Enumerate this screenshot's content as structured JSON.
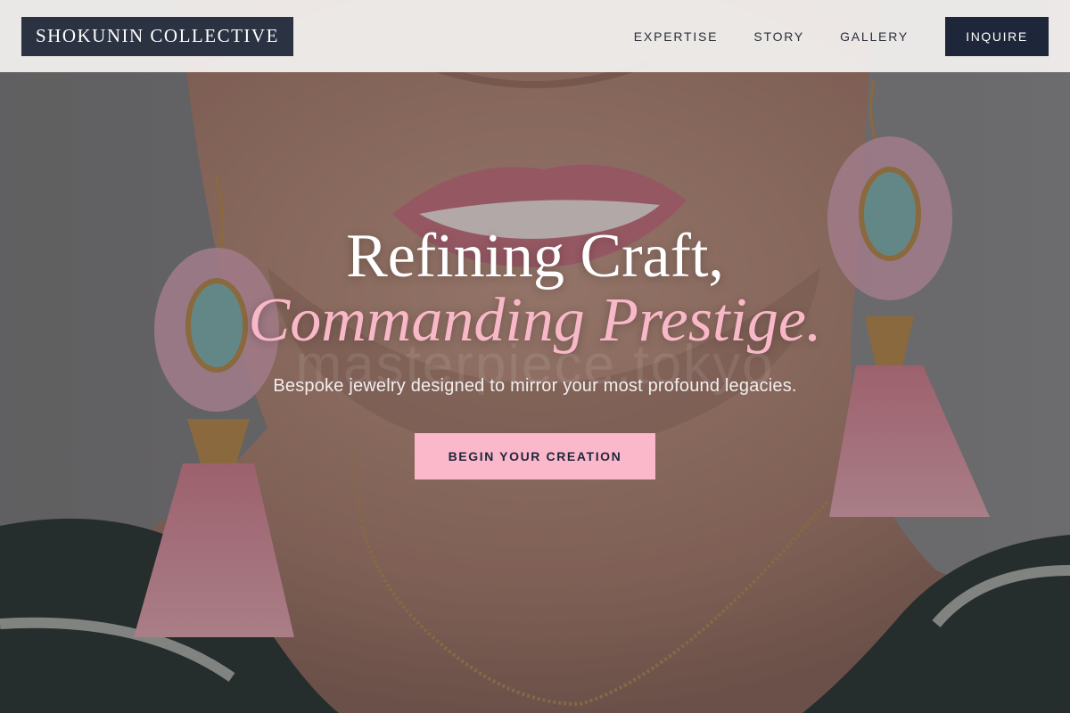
{
  "navbar": {
    "brand": "SHOKUNIN COLLECTIVE",
    "links": [
      "EXPERTISE",
      "STORY",
      "GALLERY"
    ],
    "inquire_label": "INQUIRE"
  },
  "hero": {
    "title_line_1": "Refining Craft,",
    "title_line_2": "Commanding Prestige.",
    "watermark": "masterpiece.tokyo",
    "subtitle": "Bespoke jewelry designed to mirror your most profound legacies.",
    "cta_label": "BEGIN YOUR CREATION",
    "image_subject": "model wearing pink beaded tassel earrings and gold chain necklace"
  },
  "colors": {
    "brand_bg": "#2b3342",
    "inquire_bg": "#1e2739",
    "accent_pink": "#f9b8c8",
    "cta_bg": "#fbb8cb"
  }
}
